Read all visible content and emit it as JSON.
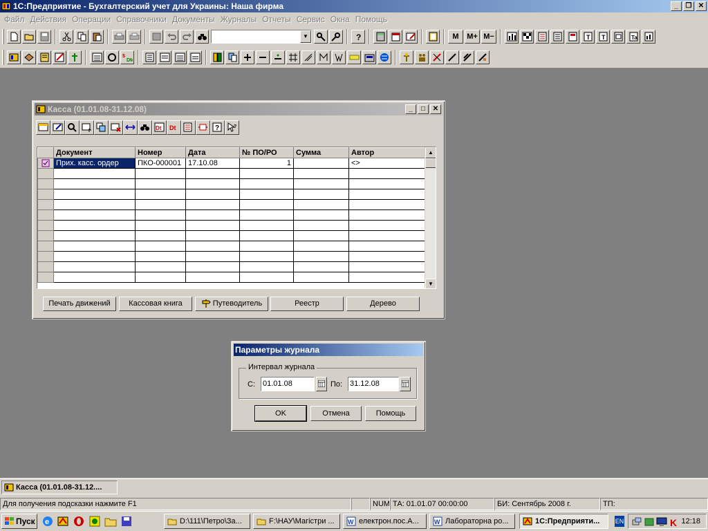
{
  "app": {
    "title": "1С:Предприятие - Бухгалтерский учет для Украины: Наша фирма",
    "win_min": "_",
    "win_restore": "❐",
    "win_close": "✕"
  },
  "menu": [
    "Файл",
    "Действия",
    "Операции",
    "Справочники",
    "Документы",
    "Журналы",
    "Отчеты",
    "Сервис",
    "Окна",
    "Помощь"
  ],
  "toolbar1": {
    "combo_value": "",
    "m_label": "M",
    "mplus_label": "M+",
    "mminus_label": "M−"
  },
  "kassa": {
    "title": "Касса (01.01.08-31.12.08)",
    "columns": [
      "Документ",
      "Номер",
      "Дата",
      "№ ПО/РО",
      "Сумма",
      "Автор"
    ],
    "rows": [
      {
        "doc": "Прих. касс. ордер",
        "num": "ПКО-000001",
        "date": "17.10.08",
        "po": "1",
        "sum": "",
        "author": "<>"
      }
    ],
    "buttons": {
      "print": "Печать движений",
      "cashbook": "Кассовая книга",
      "guide": "Путеводитель",
      "registry": "Реестр",
      "tree": "Дерево"
    }
  },
  "dialog": {
    "title": "Параметры журнала",
    "group_label": "Интервал журнала",
    "from_label": "С:",
    "from_value": "01.01.08",
    "to_label": "По:",
    "to_value": "31.12.08",
    "ok": "OK",
    "cancel": "Отмена",
    "help": "Помощь"
  },
  "mdi_taskbar": {
    "kassa": "Касса (01.01.08-31.12...."
  },
  "status": {
    "hint": "Для получения подсказки нажмите F1",
    "num": "NUM",
    "ta": "ТА: 01.01.07  00:00:00",
    "bi": "БИ: Сентябрь 2008 г.",
    "tp": "ТП:"
  },
  "os_taskbar": {
    "start": "Пуск",
    "tasks": [
      "D:\\111\\Петро\\За...",
      "F:\\НАУ\\Магістри ...",
      "електрон.пос.А...",
      "Лабораторна ро...",
      "1С:Предприяти..."
    ],
    "lang": "EN",
    "clock": "12:18"
  },
  "colors": {
    "title_active": "#0a246a",
    "title_inactive": "#808080",
    "workspace": "#808080",
    "selection": "#0a246a"
  }
}
